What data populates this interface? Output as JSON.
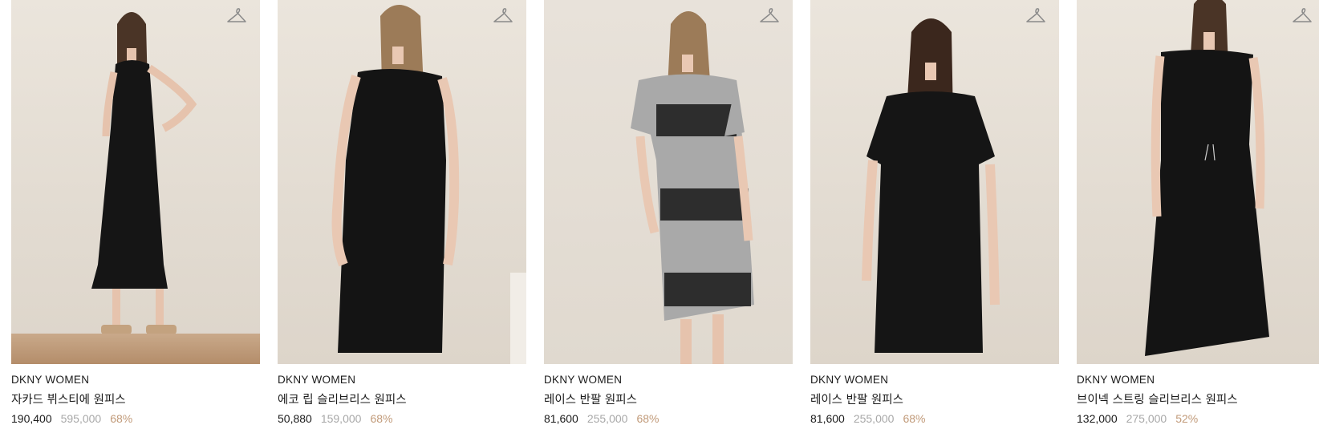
{
  "products": [
    {
      "brand": "DKNY WOMEN",
      "name": "자카드 뷔스티에 원피스",
      "price": "190,400",
      "original_price": "595,000",
      "discount": "68%",
      "dress_color": "#151515"
    },
    {
      "brand": "DKNY WOMEN",
      "name": "에코 립 슬리브리스 원피스",
      "price": "50,880",
      "original_price": "159,000",
      "discount": "68%",
      "dress_color": "#141414"
    },
    {
      "brand": "DKNY WOMEN",
      "name": "레이스 반팔 원피스",
      "price": "81,600",
      "original_price": "255,000",
      "discount": "68%",
      "dress_color": "#a8a8a8"
    },
    {
      "brand": "DKNY WOMEN",
      "name": "레이스 반팔 원피스",
      "price": "81,600",
      "original_price": "255,000",
      "discount": "68%",
      "dress_color": "#151515"
    },
    {
      "brand": "DKNY WOMEN",
      "name": "브이넥 스트링 슬리브리스 원피스",
      "price": "132,000",
      "original_price": "275,000",
      "discount": "52%",
      "dress_color": "#141414"
    }
  ],
  "icons": {
    "wishlist": "hanger-icon"
  },
  "colors": {
    "discount": "#c19a79",
    "original_price": "#a8a8a8",
    "text": "#1b1b1b"
  }
}
